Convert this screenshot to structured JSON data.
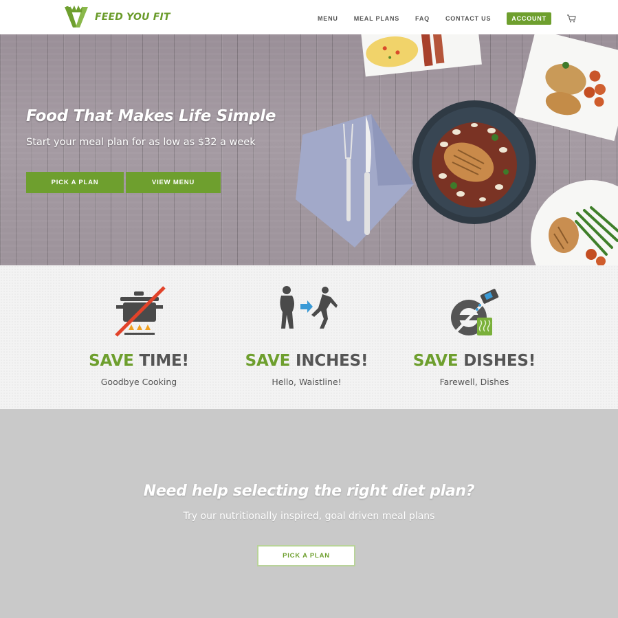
{
  "header": {
    "brand": "FEED YOU FIT",
    "nav": [
      "MENU",
      "MEAL PLANS",
      "FAQ",
      "CONTACT US"
    ],
    "account_label": "ACCOUNT",
    "cart_icon": "cart-icon"
  },
  "hero": {
    "title": "Food That Makes Life Simple",
    "subtitle": "Start your meal plan for as low as $32 a week",
    "pick_plan_label": "PICK A PLAN",
    "view_menu_label": "VIEW MENU"
  },
  "features": [
    {
      "accent": "SAVE",
      "rest": " TIME!",
      "subtitle": "Goodbye Cooking",
      "icon": "no-cooking-pot-icon"
    },
    {
      "accent": "SAVE",
      "rest": " INCHES!",
      "subtitle": "Hello, Waistline!",
      "icon": "weight-loss-runner-icon"
    },
    {
      "accent": "SAVE",
      "rest": " DISHES!",
      "subtitle": "Farewell, Dishes",
      "icon": "no-dishes-icon"
    }
  ],
  "cta": {
    "title": "Need help selecting the right diet plan?",
    "subtitle": "Try our nutritionally inspired, goal driven meal plans",
    "button_label": "PICK A PLAN"
  },
  "colors": {
    "brand_green": "#6e9f2e",
    "text_gray": "#555555",
    "cta_bg": "#c9c9c9"
  }
}
